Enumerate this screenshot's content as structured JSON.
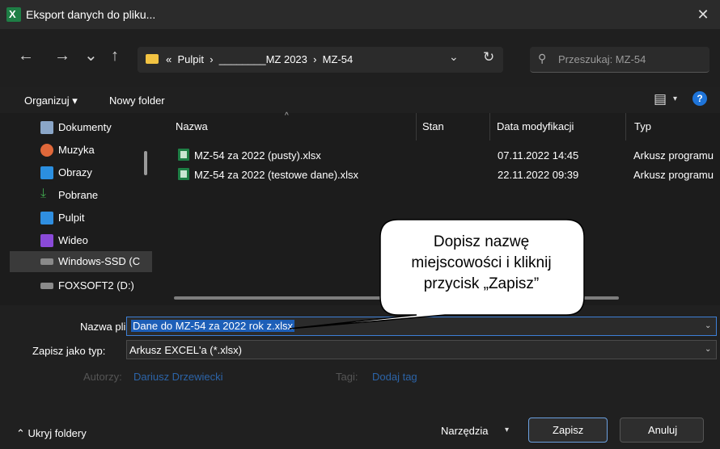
{
  "window": {
    "title": "Eksport danych do pliku...",
    "close_glyph": "✕",
    "app_icon": "excel-icon"
  },
  "nav": {
    "back": "←",
    "forward": "→",
    "recent": "⌄",
    "up": "↑",
    "breadcrumb": "«  Pulpit  ›  ________MZ 2023  ›  MZ-54",
    "dropdown": "⌄",
    "refresh": "↻",
    "search_placeholder": "Przeszukaj: MZ-54"
  },
  "toolbar": {
    "organize": "Organizuj ▾",
    "new_folder": "Nowy folder",
    "help": "?"
  },
  "sidebar": {
    "items": [
      {
        "label": "Dokumenty",
        "icon": "documents-icon",
        "color": "#8aa6c8"
      },
      {
        "label": "Muzyka",
        "icon": "music-icon",
        "color": "#e0683a"
      },
      {
        "label": "Obrazy",
        "icon": "pictures-icon",
        "color": "#2b8fe0"
      },
      {
        "label": "Pobrane",
        "icon": "download-icon",
        "color": "#3fa34d"
      },
      {
        "label": "Pulpit",
        "icon": "desktop-icon",
        "color": "#2f8ee0"
      },
      {
        "label": "Wideo",
        "icon": "video-icon",
        "color": "#8a4ad8"
      },
      {
        "label": "Windows-SSD (C",
        "icon": "drive-icon",
        "color": "#8a8a8a"
      },
      {
        "label": "FOXSOFT2 (D:)",
        "icon": "drive-icon",
        "color": "#8a8a8a"
      }
    ]
  },
  "columns": {
    "name": "Nazwa",
    "status": "Stan",
    "date": "Data modyfikacji",
    "type": "Typ"
  },
  "files": [
    {
      "name": "MZ-54 za 2022 (pusty).xlsx",
      "date": "07.11.2022 14:45",
      "type": "Arkusz programu"
    },
    {
      "name": "MZ-54 za 2022 (testowe dane).xlsx",
      "date": "22.11.2022 09:39",
      "type": "Arkusz programu"
    }
  ],
  "form": {
    "filename_label": "Nazwa pliku:",
    "filename_value": "Dane do MZ-54 za 2022 rok z.xlsx",
    "filetype_label": "Zapisz jako typ:",
    "filetype_value": "Arkusz EXCEL'a (*.xlsx)",
    "authors_label": "Autorzy:",
    "authors_value": "Dariusz Drzewiecki",
    "tags_label": "Tagi:",
    "tags_value": "Dodaj tag"
  },
  "footer": {
    "hide_folders": "⌃ Ukryj foldery",
    "tools": "Narzędzia",
    "save": "Zapisz",
    "cancel": "Anuluj"
  },
  "callout": {
    "line1": "Dopisz nazwę",
    "line2": "miejscowości i kliknij",
    "line3": "przycisk „Zapisz”"
  },
  "colors": {
    "accent": "#3d7fd6",
    "selection": "#1d5fb8",
    "link": "#2c64a8"
  }
}
